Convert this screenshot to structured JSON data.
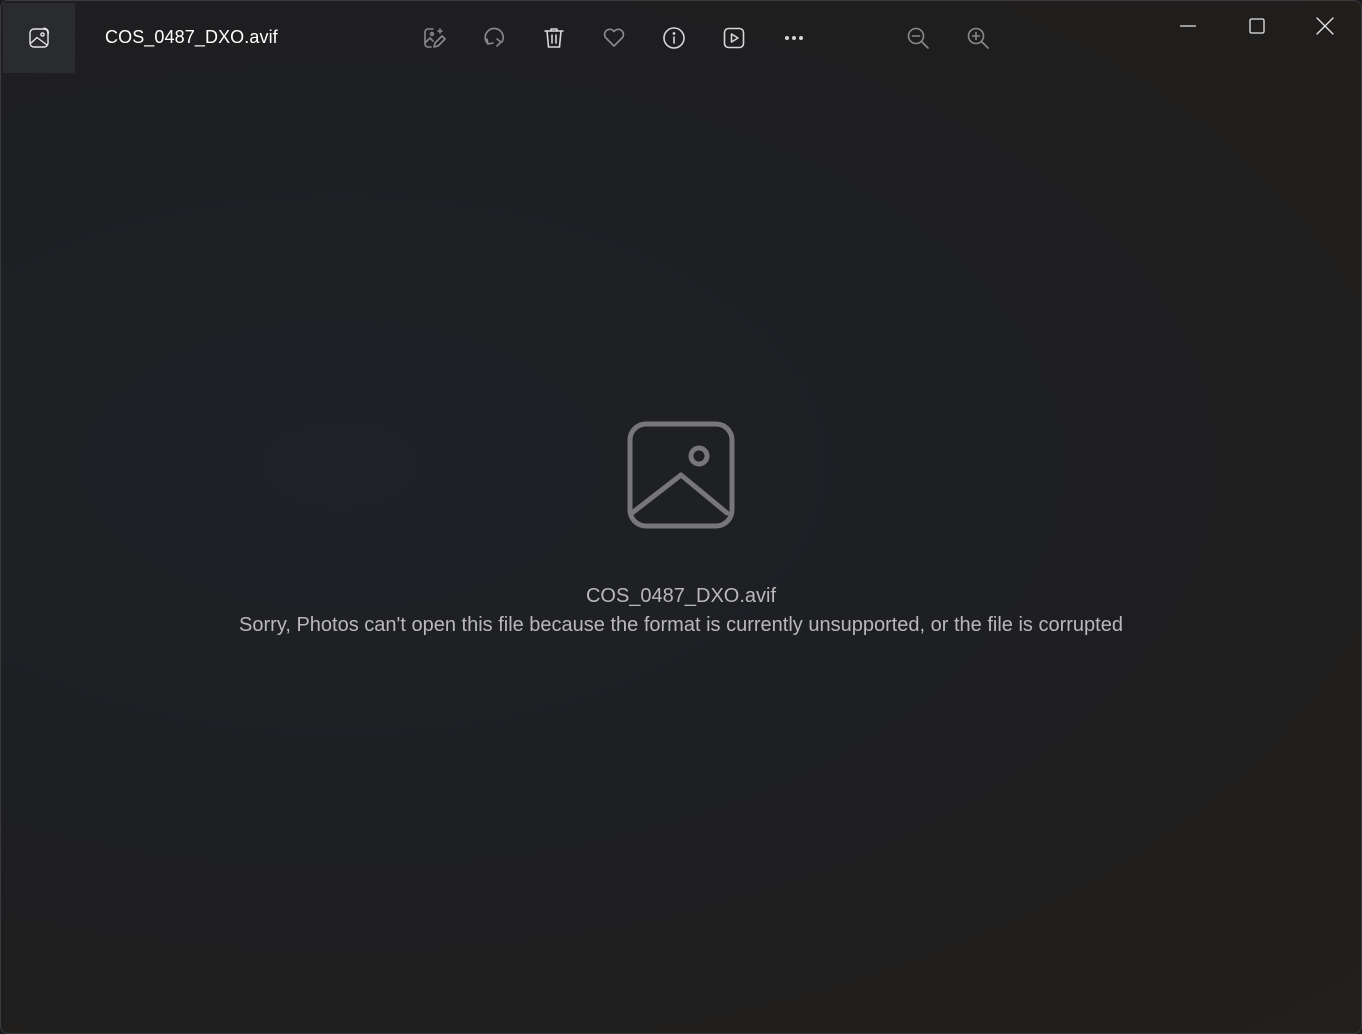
{
  "window": {
    "title": "COS_0487_DXO.avif",
    "app_icon": "photos-app-icon"
  },
  "toolbar": {
    "items": [
      {
        "name": "edit-image-button",
        "icon": "edit-image-icon",
        "tooltip": "Edit image"
      },
      {
        "name": "rotate-button",
        "icon": "rotate-icon",
        "tooltip": "Rotate"
      },
      {
        "name": "delete-button",
        "icon": "trash-icon",
        "tooltip": "Delete"
      },
      {
        "name": "favorite-button",
        "icon": "heart-icon",
        "tooltip": "Add to favorites"
      },
      {
        "name": "file-info-button",
        "icon": "info-icon",
        "tooltip": "File information"
      },
      {
        "name": "slideshow-button",
        "icon": "play-icon",
        "tooltip": "Start slideshow"
      },
      {
        "name": "more-options-button",
        "icon": "ellipsis-icon",
        "tooltip": "See more"
      },
      {
        "name": "zoom-out-button",
        "icon": "zoom-out-icon",
        "tooltip": "Zoom out"
      },
      {
        "name": "zoom-in-button",
        "icon": "zoom-in-icon",
        "tooltip": "Zoom in"
      }
    ]
  },
  "window_controls": {
    "minimize": "minimize-icon",
    "maximize": "maximize-icon",
    "close": "close-icon"
  },
  "error": {
    "icon": "image-placeholder-icon",
    "filename": "COS_0487_DXO.avif",
    "message": "Sorry, Photos can't open this file because the format is currently unsupported, or the file is corrupted"
  },
  "colors": {
    "background": "#1e1f23",
    "text_primary": "#ffffff",
    "text_secondary": "#b9b9bc",
    "icon_enabled": "#d6d6d8",
    "icon_disabled": "#8a8a8e",
    "placeholder_icon": "#77777b"
  }
}
